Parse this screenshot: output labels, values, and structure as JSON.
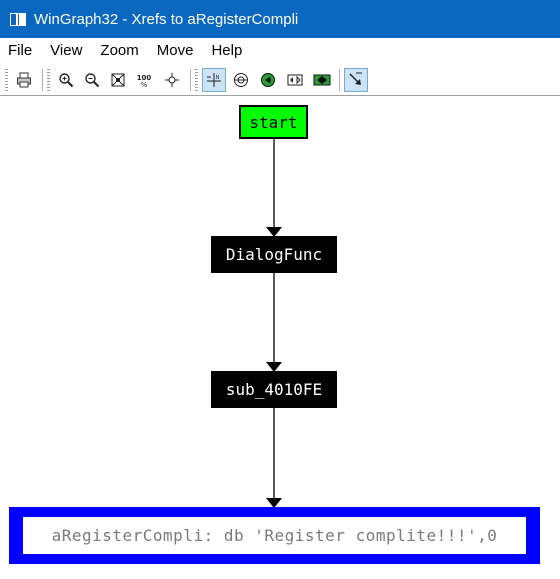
{
  "window": {
    "title": "WinGraph32 - Xrefs to aRegisterCompli"
  },
  "menu": {
    "items": [
      "File",
      "View",
      "Zoom",
      "Move",
      "Help"
    ]
  },
  "toolbar": {
    "buttons": [
      {
        "icon": "print-icon"
      },
      {
        "icon": "zoom-in-icon"
      },
      {
        "icon": "zoom-out-icon"
      },
      {
        "icon": "fit-window-icon"
      },
      {
        "icon": "zoom-100-icon",
        "label": "100%"
      },
      {
        "icon": "center-icon"
      },
      {
        "icon": "nodes-mode-icon",
        "pressed": true
      },
      {
        "icon": "chooser-icon"
      },
      {
        "icon": "graph-mode-icon"
      },
      {
        "icon": "layout-icon"
      },
      {
        "icon": "expand-icon"
      },
      {
        "icon": "edge-mode-icon",
        "pressed": true
      }
    ]
  },
  "graph": {
    "nodes": {
      "start": {
        "label": "start",
        "color": "#00ff00"
      },
      "dialog": {
        "label": "DialogFunc",
        "color": "#000000"
      },
      "sub": {
        "label": "sub_4010FE",
        "color": "#000000"
      },
      "target": {
        "label": "aRegisterCompli: db 'Register complite!!!',0",
        "color": "#0000ff"
      }
    },
    "edges": [
      {
        "from": "start",
        "to": "DialogFunc"
      },
      {
        "from": "DialogFunc",
        "to": "sub_4010FE"
      },
      {
        "from": "sub_4010FE",
        "to": "aRegisterCompli"
      }
    ]
  }
}
